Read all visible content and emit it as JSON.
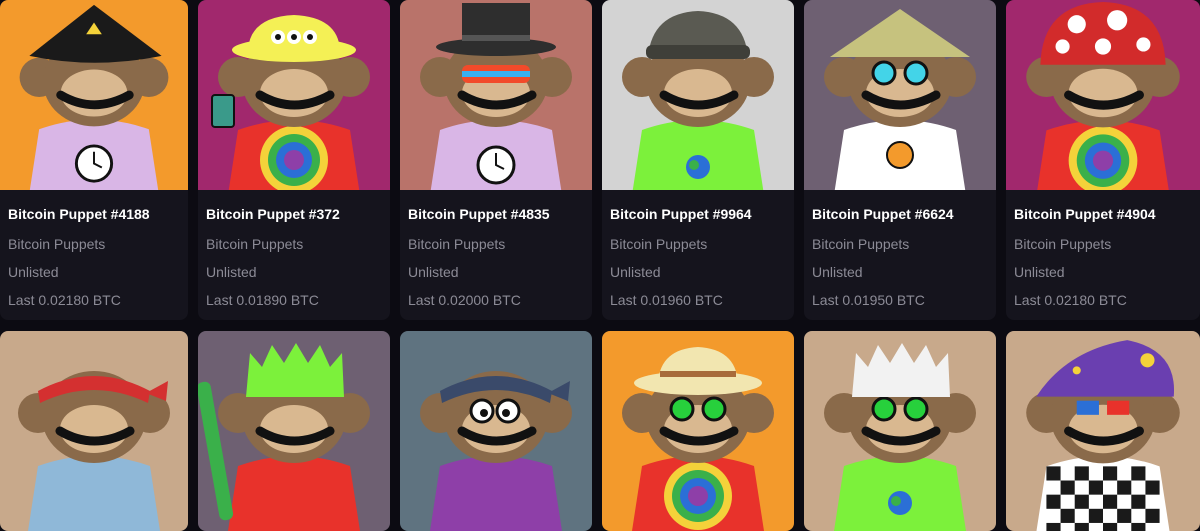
{
  "collection": "Bitcoin Puppets",
  "listings": [
    {
      "name": "Bitcoin Puppet #4188",
      "collection": "Bitcoin Puppets",
      "status": "Unlisted",
      "last": "Last 0.02180 BTC",
      "bg": "#f39a2c",
      "hat": "pyramid",
      "hatColor": "#1a1a1a",
      "shirt": "#d9b6e6",
      "eyes": "none",
      "eyewear": "",
      "accessory": "clock"
    },
    {
      "name": "Bitcoin Puppet #372",
      "collection": "Bitcoin Puppets",
      "status": "Unlisted",
      "last": "Last 0.01890 BTC",
      "bg": "#a1286d",
      "hat": "bucket",
      "hatColor": "#f4f055",
      "shirt": "tiedye",
      "eyes": "none",
      "eyewear": "",
      "accessory": "phone"
    },
    {
      "name": "Bitcoin Puppet #4835",
      "collection": "Bitcoin Puppets",
      "status": "Unlisted",
      "last": "Last 0.02000 BTC",
      "bg": "#b9736a",
      "hat": "tophat",
      "hatColor": "#2e2e2e",
      "shirt": "#d9b6e6",
      "eyes": "none",
      "eyewear": "rainbow",
      "accessory": "clock"
    },
    {
      "name": "Bitcoin Puppet #9964",
      "collection": "Bitcoin Puppets",
      "status": "Unlisted",
      "last": "Last 0.01960 BTC",
      "bg": "#d3d3d3",
      "hat": "beanie",
      "hatColor": "#5a5a52",
      "shirt": "#7cf13b",
      "eyes": "none",
      "eyewear": "",
      "accessory": "globe"
    },
    {
      "name": "Bitcoin Puppet #6624",
      "collection": "Bitcoin Puppets",
      "status": "Unlisted",
      "last": "Last 0.01950 BTC",
      "bg": "#6e6072",
      "hat": "conical",
      "hatColor": "#c6c27e",
      "shirt": "#ffffff",
      "eyes": "none",
      "eyewear": "cyan",
      "accessory": "bitcoin"
    },
    {
      "name": "Bitcoin Puppet #4904",
      "collection": "Bitcoin Puppets",
      "status": "Unlisted",
      "last": "Last 0.02180 BTC",
      "bg": "#a1286d",
      "hat": "mushroom",
      "hatColor": "#d22b2b",
      "shirt": "tiedye",
      "eyes": "none",
      "eyewear": "",
      "accessory": "none"
    },
    {
      "name": "",
      "collection": "",
      "status": "",
      "last": "",
      "bg": "#c8a98b",
      "hat": "bandana",
      "hatColor": "#d43030",
      "shirt": "#8fb8d8",
      "eyes": "none",
      "eyewear": "",
      "accessory": "none"
    },
    {
      "name": "",
      "collection": "",
      "status": "",
      "last": "",
      "bg": "#6e6072",
      "hat": "spiky",
      "hatColor": "#7cf13b",
      "shirt": "#e8322b",
      "eyes": "none",
      "eyewear": "",
      "accessory": "bat"
    },
    {
      "name": "",
      "collection": "",
      "status": "",
      "last": "",
      "bg": "#5f7380",
      "hat": "bandana",
      "hatColor": "#3a4a6a",
      "shirt": "#8e3fa8",
      "eyes": "googly",
      "eyewear": "",
      "accessory": "none"
    },
    {
      "name": "",
      "collection": "",
      "status": "",
      "last": "",
      "bg": "#f39a2c",
      "hat": "safari",
      "hatColor": "#f2e6b0",
      "shirt": "tiedye",
      "eyes": "none",
      "eyewear": "green",
      "accessory": "none"
    },
    {
      "name": "",
      "collection": "",
      "status": "",
      "last": "",
      "bg": "#c8a98b",
      "hat": "spiky",
      "hatColor": "#f2f2f2",
      "shirt": "#7cf13b",
      "eyes": "none",
      "eyewear": "green",
      "accessory": "globe"
    },
    {
      "name": "",
      "collection": "",
      "status": "",
      "last": "",
      "bg": "#c8a98b",
      "hat": "wizard",
      "hatColor": "#6a3fb0",
      "shirt": "checker",
      "eyes": "none",
      "eyewear": "3d",
      "accessory": "none"
    }
  ]
}
